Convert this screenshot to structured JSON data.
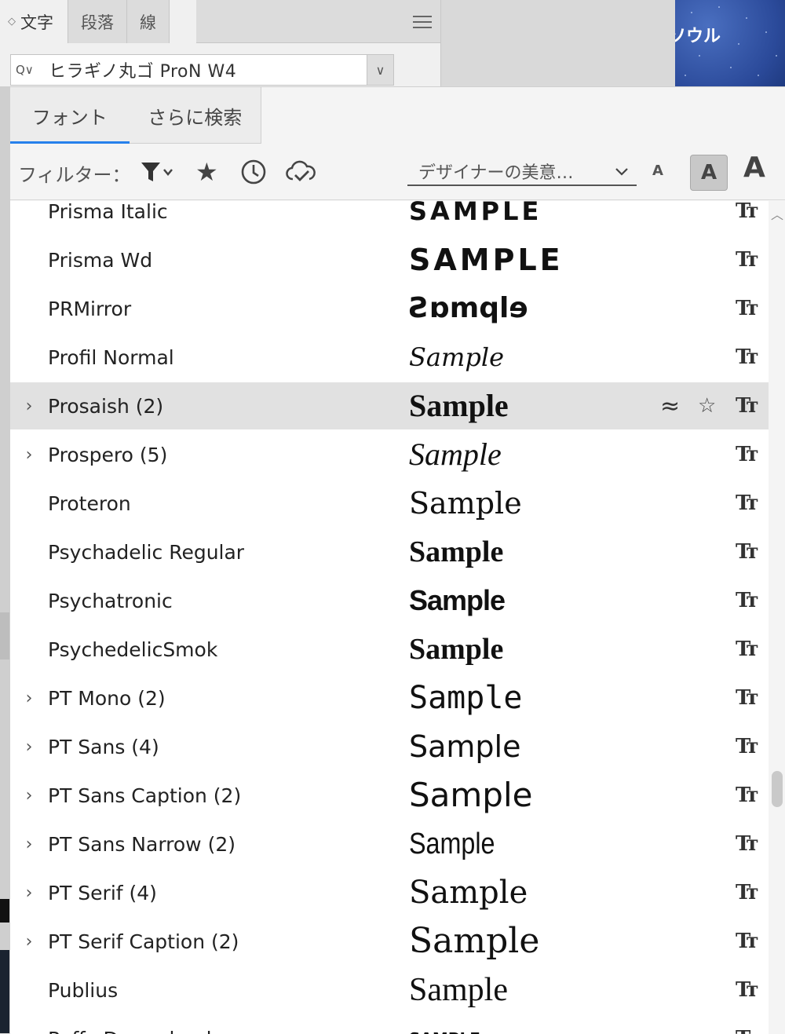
{
  "background": {
    "right_text": "ソウル"
  },
  "character_panel": {
    "tab_update_glyph": "◇",
    "tabs": [
      "文字",
      "段落",
      "線"
    ],
    "font_field": {
      "value": "ヒラギノ丸ゴ ProN W4",
      "search_glyph": "Q∨",
      "dropdown_glyph": "∨"
    }
  },
  "font_popup": {
    "tabs": [
      "フォント",
      "さらに検索"
    ],
    "filter_label": "フィルター：",
    "icons": {
      "funnel": "funnel-icon",
      "star": "star-icon",
      "recent": "clock-icon",
      "cloud": "cloud-check-icon"
    },
    "similar_dropdown": "デザイナーの美意…",
    "sample_sizes": [
      "A",
      "A",
      "A"
    ],
    "selected_sample_size": "medium",
    "rows": [
      {
        "name": "Prisma Italic",
        "sample": "SAMPLE",
        "expandable": false
      },
      {
        "name": "Prisma Wd",
        "sample": "SAMPLE",
        "expandable": false
      },
      {
        "name": "PRMirror",
        "sample": "Ƨɒmqlɘ",
        "expandable": false
      },
      {
        "name": "Profil Normal",
        "sample": "Sample",
        "expandable": false
      },
      {
        "name": "Prosaish (2)",
        "sample": "Sample",
        "expandable": true,
        "selected": true
      },
      {
        "name": "Prospero (5)",
        "sample": "Sample",
        "expandable": true
      },
      {
        "name": "Proteron",
        "sample": "Sample",
        "expandable": false
      },
      {
        "name": "Psychadelic Regular",
        "sample": "Sample",
        "expandable": false
      },
      {
        "name": "Psychatronic",
        "sample": "Sample",
        "expandable": false
      },
      {
        "name": "PsychedelicSmok",
        "sample": "Sample",
        "expandable": false
      },
      {
        "name": "PT Mono (2)",
        "sample": "Sample",
        "expandable": true
      },
      {
        "name": "PT Sans (4)",
        "sample": "Sample",
        "expandable": true
      },
      {
        "name": "PT Sans Caption (2)",
        "sample": "Sample",
        "expandable": true
      },
      {
        "name": "PT Sans Narrow (2)",
        "sample": "Sample",
        "expandable": true
      },
      {
        "name": "PT Serif (4)",
        "sample": "Sample",
        "expandable": true
      },
      {
        "name": "PT Serif Caption (2)",
        "sample": "Sample",
        "expandable": true
      },
      {
        "name": "Publius",
        "sample": "Sample",
        "expandable": false
      },
      {
        "name": "Puffy Dreamland",
        "sample": "SAMPLE",
        "expandable": false
      }
    ],
    "row_glyphs": {
      "expand": "›",
      "font_type": "Tт",
      "similar": "≈",
      "favorite": "☆"
    }
  }
}
